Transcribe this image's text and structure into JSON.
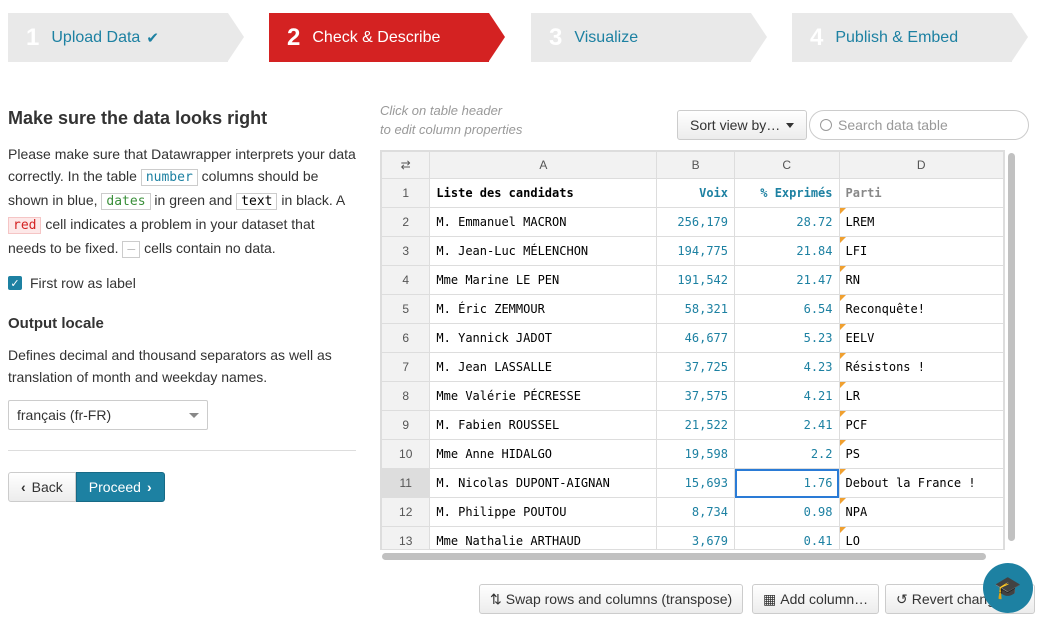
{
  "steps": [
    {
      "num": "1",
      "label": "Upload Data",
      "check": "✔"
    },
    {
      "num": "2",
      "label": "Check & Describe"
    },
    {
      "num": "3",
      "label": "Visualize"
    },
    {
      "num": "4",
      "label": "Publish & Embed"
    }
  ],
  "left": {
    "title": "Make sure the data looks right",
    "p1_a": "Please make sure that Datawrapper interprets your data correctly. In the table ",
    "code_number": "number",
    "p1_b": " columns should be shown in blue, ",
    "code_dates": "dates",
    "p1_c": " in green and ",
    "code_text": "text",
    "p1_d": " in black. A ",
    "code_red": "red",
    "p1_e": " cell indicates a problem in your dataset that needs to be fixed. ",
    "code_empty": "–",
    "p1_f": " cells contain no data.",
    "first_row_label": "First row as label",
    "output_locale_title": "Output locale",
    "locale_desc": "Defines decimal and thousand separators as well as translation of month and weekday names.",
    "locale_value": "français (fr-FR)",
    "back": "Back",
    "proceed": "Proceed"
  },
  "hint_line1": "Click on table header",
  "hint_line2": "to edit column properties",
  "sort_label": "Sort view by…",
  "search_placeholder": "Search data table",
  "table": {
    "columns": [
      "A",
      "B",
      "C",
      "D"
    ],
    "rows": [
      {
        "n": "1",
        "a": "Liste des candidats",
        "b": "Voix",
        "c": "% Exprimés",
        "d": "Parti"
      },
      {
        "n": "2",
        "a": "M. Emmanuel MACRON",
        "b": "256,179",
        "c": "28.72",
        "d": "LREM"
      },
      {
        "n": "3",
        "a": "M. Jean-Luc MÉLENCHON",
        "b": "194,775",
        "c": "21.84",
        "d": "LFI"
      },
      {
        "n": "4",
        "a": "Mme Marine LE PEN",
        "b": "191,542",
        "c": "21.47",
        "d": "RN"
      },
      {
        "n": "5",
        "a": "M. Éric ZEMMOUR",
        "b": "58,321",
        "c": "6.54",
        "d": "Reconquête!"
      },
      {
        "n": "6",
        "a": "M. Yannick JADOT",
        "b": "46,677",
        "c": "5.23",
        "d": "EELV"
      },
      {
        "n": "7",
        "a": "M. Jean LASSALLE",
        "b": "37,725",
        "c": "4.23",
        "d": "Résistons !"
      },
      {
        "n": "8",
        "a": "Mme Valérie PÉCRESSE",
        "b": "37,575",
        "c": "4.21",
        "d": "LR"
      },
      {
        "n": "9",
        "a": "M. Fabien ROUSSEL",
        "b": "21,522",
        "c": "2.41",
        "d": "PCF"
      },
      {
        "n": "10",
        "a": "Mme Anne HIDALGO",
        "b": "19,598",
        "c": "2.2",
        "d": "PS"
      },
      {
        "n": "11",
        "a": "M. Nicolas DUPONT-AIGNAN",
        "b": "15,693",
        "c": "1.76",
        "d": "Debout la France !"
      },
      {
        "n": "12",
        "a": "M. Philippe POUTOU",
        "b": "8,734",
        "c": "0.98",
        "d": "NPA"
      },
      {
        "n": "13",
        "a": "Mme Nathalie ARTHAUD",
        "b": "3,679",
        "c": "0.41",
        "d": "LO"
      }
    ]
  },
  "bottom": {
    "transpose": "Swap rows and columns (transpose)",
    "add_column": "Add column…",
    "revert": "Revert changes…"
  },
  "colors": {
    "accent": "#1d81a2",
    "active_step": "#d42222"
  }
}
